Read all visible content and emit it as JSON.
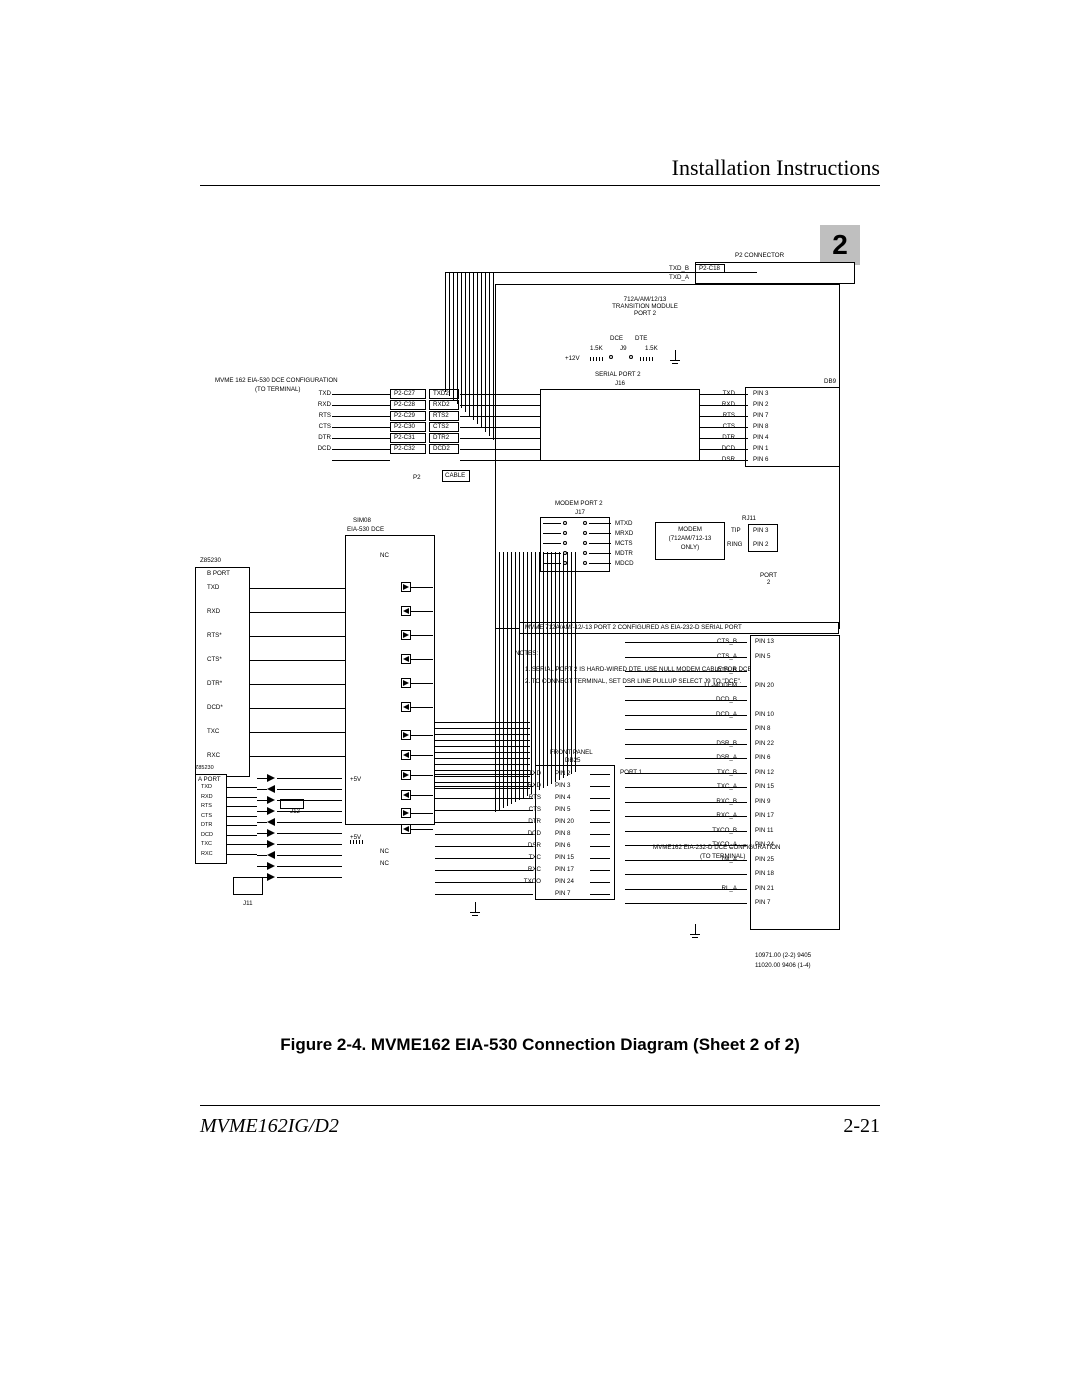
{
  "header": {
    "section": "Installation Instructions",
    "chapter": "2"
  },
  "footer": {
    "left": "MVME162IG/D2",
    "right": "2-21"
  },
  "caption": "Figure 2-4.  MVME162 EIA-530 Connection Diagram (Sheet 2 of 2)",
  "p2_connector": "P2 CONNECTOR",
  "txd_b": "TXD_B",
  "txd_a": "TXD_A",
  "p2c18": "P2-C18",
  "tm_block": "712A/AM/12/13\nTRANSITION MODULE\nPORT 2",
  "dce": "DCE",
  "dte": "DTE",
  "r1_5k": "1.5K",
  "j9": "J9",
  "p12v": "+12V",
  "serial_port2": "SERIAL PORT 2",
  "j16": "J16",
  "dce_cfg": "MVME 162 EIA-530 DCE CONFIGURATION",
  "to_terminal": "(TO TERMINAL)",
  "sp_rows": [
    {
      "l": "TXD",
      "c": "P2-C27",
      "r": "TXD2",
      "far": "TXD",
      "pin": "PIN 3"
    },
    {
      "l": "RXD",
      "c": "P2-C28",
      "r": "RXD2",
      "far": "RXD",
      "pin": "PIN 2"
    },
    {
      "l": "RTS",
      "c": "P2-C29",
      "r": "RTS2",
      "far": "RTS",
      "pin": "PIN 7"
    },
    {
      "l": "CTS",
      "c": "P2-C30",
      "r": "CTS2",
      "far": "CTS",
      "pin": "PIN 8"
    },
    {
      "l": "DTR",
      "c": "P2-C31",
      "r": "DTR2",
      "far": "DTR",
      "pin": "PIN 4"
    },
    {
      "l": "DCD",
      "c": "P2-C32",
      "r": "DCD2",
      "far": "DCD",
      "pin": "PIN 1"
    },
    {
      "l": "",
      "c": "",
      "r": "",
      "far": "DSR",
      "pin": "PIN 6"
    }
  ],
  "p2_lbl": "P2",
  "cable": "CABLE",
  "db9": "DB9",
  "modem_port2": "MODEM PORT 2",
  "j17": "J17",
  "modem_rows": [
    "MTXD",
    "MRXD",
    "MCTS",
    "MDTR",
    "MDCD"
  ],
  "modem_box": {
    "t": "MODEM",
    "m": "(712AM/712-13",
    "b": "ONLY)"
  },
  "rj11": "RJ11",
  "tip": "TIP",
  "ring": "RING",
  "pin3": "PIN 3",
  "pin2": "PIN 2",
  "port2_side": "PORT\n2",
  "sim08": "SIM08",
  "eia530dce": "EIA-530 DCE",
  "nc": "NC",
  "z85230": "Z85230",
  "bport": "B PORT",
  "aport": "A PORT",
  "bport_rows": [
    "TXD",
    "RXD",
    "RTS*",
    "CTS*",
    "DTR*",
    "DCD*",
    "TXC",
    "RXC"
  ],
  "aport_rows": [
    "TXD",
    "RXD",
    "RTS",
    "CTS",
    "DTR",
    "DCD",
    "TXC",
    "RXC"
  ],
  "p5v": "+5V",
  "j11": "J11",
  "j12": "J12",
  "note_title": "MVME 712A/AM/-12/-13 PORT 2 CONFIGURED AS EIA-232-D SERIAL PORT",
  "notes_lbl": "NOTES:",
  "note1": "1.   SERIAL PORT 2 IS HARD-WIRED DTE.  USE NULL MODEM CABLE FOR DCE.",
  "note2": "2.   TO CONNECT TERMINAL, SET DSR  LINE PULLUP SELECT J9 TO \"DCE\".",
  "right_pins": [
    {
      "a": "CTS_B",
      "p": "PIN 13"
    },
    {
      "a": "CTS_A",
      "p": "PIN 5"
    },
    {
      "a": "DTR_B",
      "p": ""
    },
    {
      "a": "LL-MODEM",
      "p": "PIN 20"
    },
    {
      "a": "DCD_B",
      "p": ""
    },
    {
      "a": "DCD_A",
      "p": "PIN 10"
    },
    {
      "a": "",
      "p": "PIN 8"
    },
    {
      "a": "DSR_B",
      "p": "PIN 22"
    },
    {
      "a": "DSR_A",
      "p": "PIN 6"
    },
    {
      "a": "TXC_B",
      "p": "PIN 12"
    },
    {
      "a": "TXC_A",
      "p": "PIN 15"
    },
    {
      "a": "RXC_B",
      "p": "PIN 9"
    },
    {
      "a": "RXC_A",
      "p": "PIN 17"
    },
    {
      "a": "TXCO_B",
      "p": "PIN 11"
    },
    {
      "a": "TXCO_A",
      "p": "PIN 24"
    },
    {
      "a": "TM_A",
      "p": "PIN 25"
    },
    {
      "a": "",
      "p": "PIN 18"
    },
    {
      "a": "RL_A",
      "p": "PIN 21"
    },
    {
      "a": "",
      "p": "PIN 7"
    }
  ],
  "front_panel": "FRONT PANEL",
  "db25": "DB25",
  "port1": "PORT 1",
  "fp_rows": [
    {
      "s": "TXD",
      "p": "PIN 2"
    },
    {
      "s": "RXD",
      "p": "PIN 3"
    },
    {
      "s": "RTS",
      "p": "PIN 4"
    },
    {
      "s": "CTS",
      "p": "PIN 5"
    },
    {
      "s": "DTR",
      "p": "PIN 20"
    },
    {
      "s": "DCD",
      "p": "PIN 8"
    },
    {
      "s": "DSR",
      "p": "PIN 6"
    },
    {
      "s": "TXC",
      "p": "PIN 15"
    },
    {
      "s": "RXC",
      "p": "PIN 17"
    },
    {
      "s": "TXCO",
      "p": "PIN 24"
    },
    {
      "s": "",
      "p": "PIN 7"
    }
  ],
  "right_cfg1": "MVME162 EIA-232-D  DCE CONFIGURATION",
  "right_cfg2": "(TO TERMINAL)",
  "drawing_ids": [
    "10971.00 (2-2) 9405",
    "11020.00 9406 (1-4)"
  ]
}
